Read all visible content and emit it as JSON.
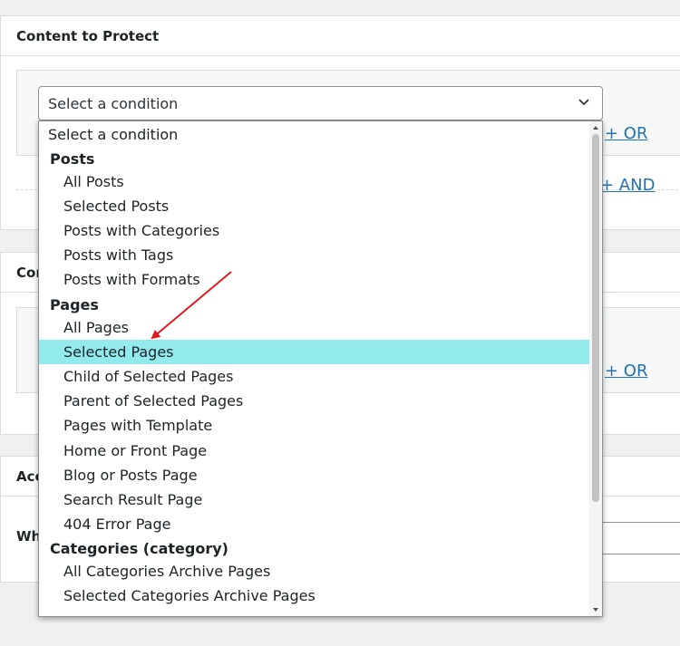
{
  "panels": {
    "content_to_protect": {
      "title": "Content to Protect"
    },
    "second": {
      "title": "Con"
    },
    "third": {
      "title": "Acc",
      "row_label": "Wh"
    }
  },
  "links": {
    "or_1": "+ OR",
    "and_1": "+ AND",
    "or_2": "+ OR"
  },
  "select": {
    "value": "Select a condition"
  },
  "dropdown": {
    "placeholder": "Select a condition",
    "groups": [
      {
        "label": "Posts",
        "items": [
          "All Posts",
          "Selected Posts",
          "Posts with Categories",
          "Posts with Tags",
          "Posts with Formats"
        ]
      },
      {
        "label": "Pages",
        "items": [
          "All Pages",
          "Selected Pages",
          "Child of Selected Pages",
          "Parent of Selected Pages",
          "Pages with Template",
          "Home or Front Page",
          "Blog or Posts Page",
          "Search Result Page",
          "404 Error Page"
        ]
      },
      {
        "label": "Categories (category)",
        "items": [
          "All Categories Archive Pages",
          "Selected Categories Archive Pages"
        ]
      }
    ],
    "highlighted": "Selected Pages"
  },
  "colors": {
    "highlight": "#93eaec",
    "link": "#2271b1",
    "arrow": "#e0191e"
  },
  "icons": {
    "select_caret": "chevron-down-icon",
    "annotation": "red-arrow"
  }
}
